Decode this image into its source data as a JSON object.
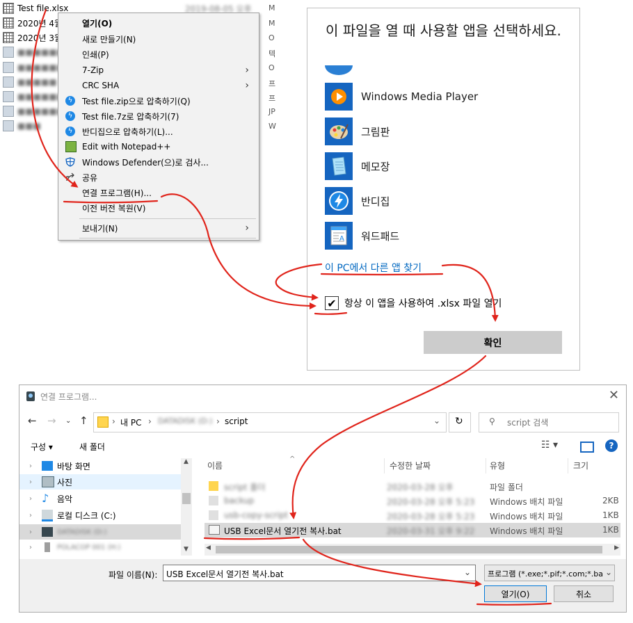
{
  "explorer": {
    "rows": [
      {
        "name": "Test file.xlsx",
        "date": "2019-08-05 오후",
        "type": "M"
      },
      {
        "name": "2020년 4월",
        "type": "M"
      },
      {
        "name": "2020년 3월",
        "type": "O"
      },
      {
        "type": "텍"
      },
      {
        "type": "O"
      },
      {
        "type": "프"
      },
      {
        "type": "프"
      },
      {
        "type": "JP"
      },
      {
        "type": "W"
      }
    ]
  },
  "context_menu": {
    "items": [
      {
        "label": "열기(O)"
      },
      {
        "label": "새로 만들기(N)"
      },
      {
        "label": "인쇄(P)"
      },
      {
        "label": "7-Zip"
      },
      {
        "label": "CRC SHA"
      },
      {
        "label": "Test file.zip으로 압축하기(Q)"
      },
      {
        "label": "Test file.7z로 압축하기(7)"
      },
      {
        "label": "반디집으로 압축하기(L)..."
      },
      {
        "label": "Edit with Notepad++"
      },
      {
        "label": "Windows Defender(으)로 검사..."
      },
      {
        "label": "공유"
      },
      {
        "label": "연결 프로그램(H)..."
      },
      {
        "label": "이전 버전 복원(V)"
      },
      {
        "label": "보내기(N)"
      }
    ]
  },
  "open_with": {
    "title": "이 파일을 열 때 사용할 앱을 선택하세요.",
    "apps": [
      {
        "label": "Windows Media Player"
      },
      {
        "label": "그림판"
      },
      {
        "label": "메모장"
      },
      {
        "label": "반디집"
      },
      {
        "label": "워드패드"
      }
    ],
    "find_more": "이 PC에서 다른 앱 찾기",
    "always_use": "항상 이 앱을 사용하여 .xlsx 파일 열기",
    "always_checked": "✔",
    "ok_label": "확인"
  },
  "file_dialog": {
    "title": "연결 프로그램...",
    "address": {
      "pc": "내 PC",
      "drive": "DATADISK (D:)",
      "folder": "script"
    },
    "search_placeholder": "script 검색",
    "toolbar": {
      "organize": "구성 ▾",
      "new_folder": "새 폴더"
    },
    "nav_items": [
      {
        "label": "바탕 화면"
      },
      {
        "label": "사진"
      },
      {
        "label": "음악"
      },
      {
        "label": "로컬 디스크 (C:)"
      },
      {
        "label": "DATADISK (D:)"
      },
      {
        "label": "POLACOP 001 (H:)"
      }
    ],
    "columns": {
      "name": "이름",
      "date": "수정한 날짜",
      "type": "유형",
      "size": "크기"
    },
    "files": [
      {
        "name": "script 폴더",
        "date": "2020-03-28 오후",
        "type": "파일 폴더",
        "size": ""
      },
      {
        "name": "backup",
        "date": "2020-03-28 오후 5:23",
        "type": "Windows 배치 파일",
        "size": "2KB"
      },
      {
        "name": "usb-copy-script",
        "date": "2020-03-28 오후 5:23",
        "type": "Windows 배치 파일",
        "size": "1KB"
      },
      {
        "name": "USB Excel문서 열기전 복사.bat",
        "date": "2020-03-31 오후 9:22",
        "type": "Windows 배치 파일",
        "size": "1KB"
      }
    ],
    "filename_label": "파일 이름(N):",
    "filename_value": "USB Excel문서 열기전 복사.bat",
    "filetype_value": "프로그램 (*.exe;*.pif;*.com;*.bat;",
    "open_label": "열기(O)",
    "cancel_label": "취소"
  },
  "colors": {
    "annotation_red": "#e0241b",
    "link_blue": "#0067c0",
    "selection_bg": "#cce8ff",
    "ok_button_bg": "#cccccc"
  }
}
